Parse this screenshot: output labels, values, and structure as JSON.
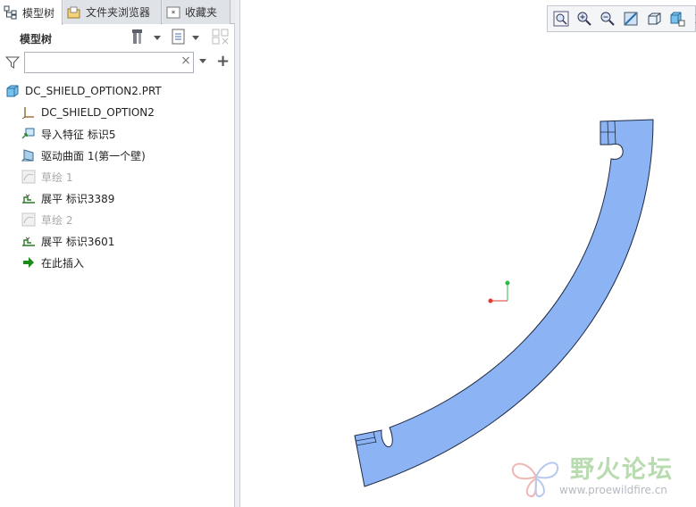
{
  "tabs": [
    {
      "label": "模型树",
      "icon": "model-tree-icon",
      "active": true
    },
    {
      "label": "文件夹浏览器",
      "icon": "folder-browser-icon",
      "active": false
    },
    {
      "label": "收藏夹",
      "icon": "favorites-icon",
      "active": false
    }
  ],
  "panel": {
    "title": "模型树",
    "tools": [
      "settings-icon",
      "show-icon",
      "column-display-icon"
    ]
  },
  "search": {
    "placeholder": "",
    "value": "",
    "clear": "×"
  },
  "tree": [
    {
      "label": "DC_SHIELD_OPTION2.PRT",
      "icon": "part-icon",
      "disabled": false
    },
    {
      "label": "DC_SHIELD_OPTION2",
      "icon": "coordinate-system-icon",
      "disabled": false
    },
    {
      "label": "导入特征 标识5",
      "icon": "import-feature-icon",
      "disabled": false
    },
    {
      "label": "驱动曲面 1(第一个壁)",
      "icon": "driving-surface-icon",
      "disabled": false
    },
    {
      "label": "草绘 1",
      "icon": "sketch-icon",
      "disabled": true
    },
    {
      "label": "展平 标识3389",
      "icon": "flatten-icon",
      "disabled": false
    },
    {
      "label": "草绘 2",
      "icon": "sketch-icon",
      "disabled": true
    },
    {
      "label": "展平 标识3601",
      "icon": "flatten-icon",
      "disabled": false
    },
    {
      "label": "在此插入",
      "icon": "insert-here-arrow-icon",
      "disabled": false
    }
  ],
  "graphics_toolbar": [
    "refit-icon",
    "zoom-in-icon",
    "zoom-out-icon",
    "repaint-icon",
    "view-orientation-icon",
    "saved-views-icon",
    "overflow-arrow-icon"
  ],
  "colors": {
    "part_fill": "#8cb4f5",
    "part_stroke": "#1e2a44",
    "axis_x": "#e23a2e",
    "axis_y": "#2eb84a",
    "insert_arrow": "#1a8a1a"
  },
  "watermark": {
    "title": "野火论坛",
    "url": "www.proewildfire.cn"
  }
}
